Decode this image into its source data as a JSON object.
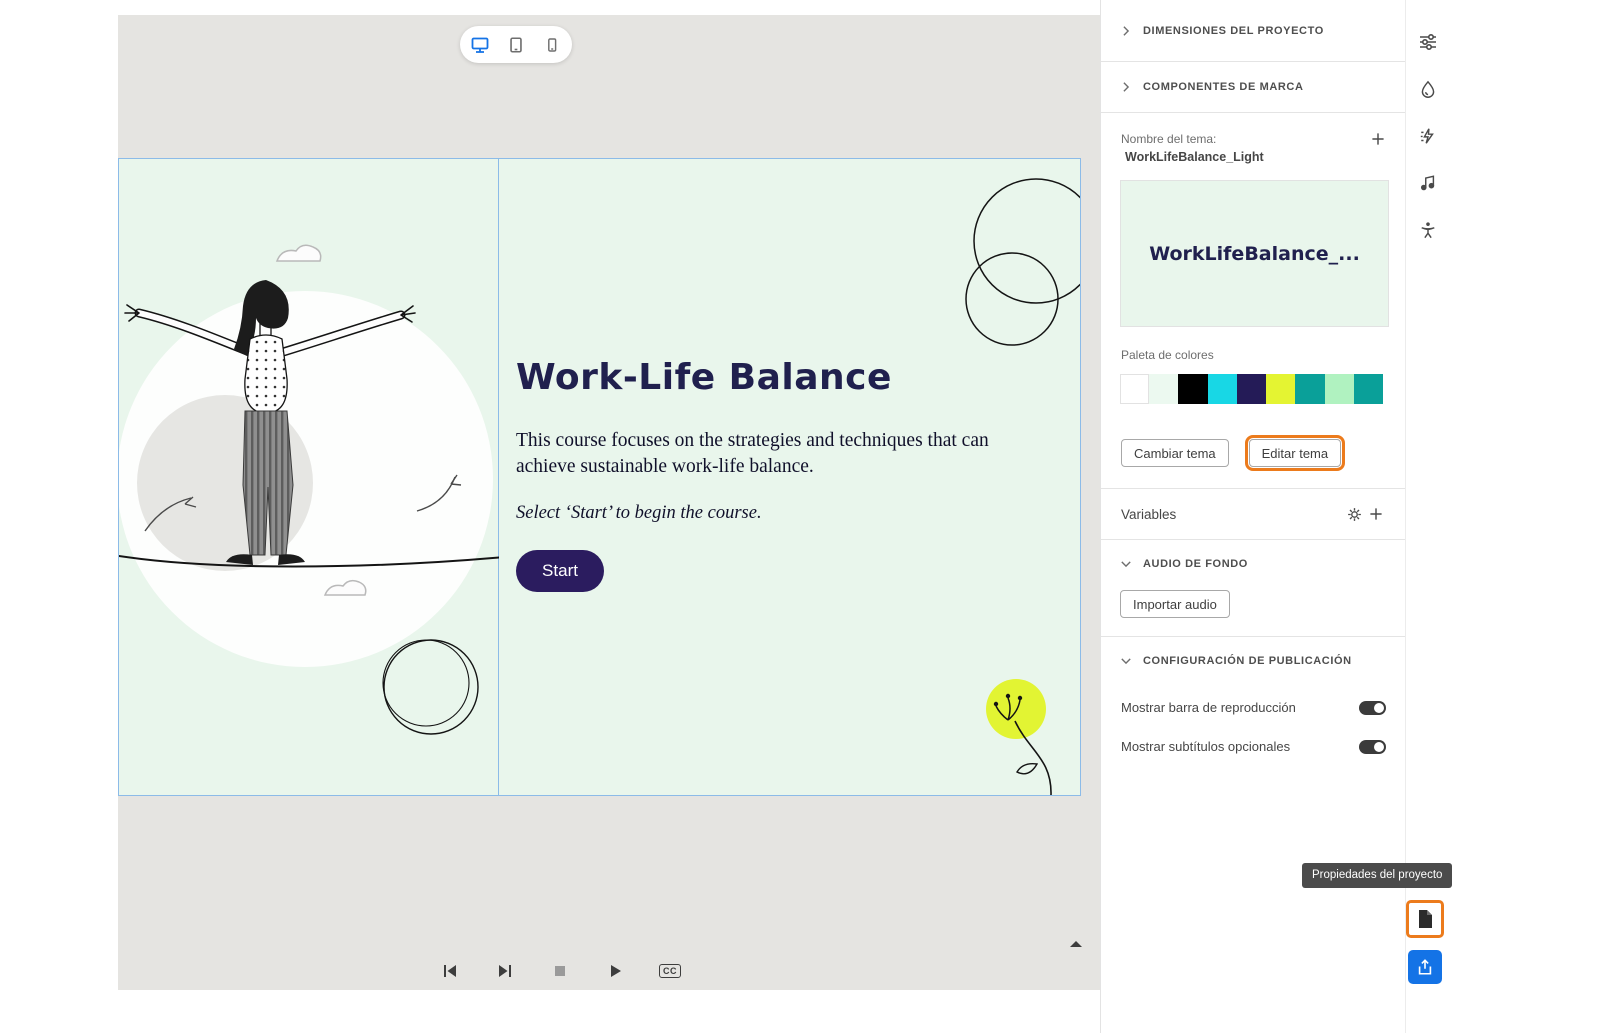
{
  "colors": {
    "accent_blue": "#1473e6",
    "annotation_orange": "#ec7b1c",
    "slide_background": "#e9f6ec",
    "slide_ink": "#20204e",
    "start_button_bg": "#2b1c5f",
    "canvas_background": "#e5e4e1",
    "yellow_accent": "#e2f433"
  },
  "device_toolbar": {
    "items": [
      {
        "name": "desktop",
        "icon": "desktop-icon",
        "active": true
      },
      {
        "name": "tablet",
        "icon": "tablet-icon",
        "active": false
      },
      {
        "name": "mobile",
        "icon": "mobile-icon",
        "active": false
      }
    ]
  },
  "slide": {
    "title": "Work-Life Balance",
    "body": "This course focuses on the strategies and techniques that can achieve sustainable work-life balance.",
    "instruction": "Select ‘Start’ to begin the course.",
    "start_button": "Start"
  },
  "playback": {
    "controls": [
      "skip-back",
      "skip-forward",
      "stop",
      "play",
      "closed-captions"
    ],
    "cc_label": "CC"
  },
  "panel": {
    "section_dimensions": "DIMENSIONES DEL PROYECTO",
    "section_brand": "COMPONENTES DE MARCA",
    "theme_name_label": "Nombre del tema:",
    "theme_name": "WorkLifeBalance_Light",
    "theme_preview_text": "WorkLifeBalance_...",
    "palette_label": "Paleta de colores",
    "palette": [
      "#ffffff",
      "#ecf9f0",
      "#000000",
      "#18d7e5",
      "#241b57",
      "#e4f432",
      "#0aa099",
      "#b0f2c0",
      "#0aa099"
    ],
    "change_theme": "Cambiar tema",
    "edit_theme": "Editar tema",
    "variables_label": "Variables",
    "section_audio": "AUDIO DE FONDO",
    "import_audio": "Importar audio",
    "section_publish": "CONFIGURACIÓN DE PUBLICACIÓN",
    "show_playbar_label": "Mostrar barra de reproducción",
    "show_captions_label": "Mostrar subtítulos opcionales",
    "show_playbar_on": true,
    "show_captions_on": true
  },
  "tooltip": {
    "text": "Propiedades del proyecto"
  },
  "right_rail": {
    "icons": [
      "sliders-icon",
      "color-drop-icon",
      "interactions-icon",
      "music-note-icon",
      "accessibility-icon"
    ],
    "project_properties_icon": "document-icon",
    "share_icon": "share-upload-icon"
  }
}
